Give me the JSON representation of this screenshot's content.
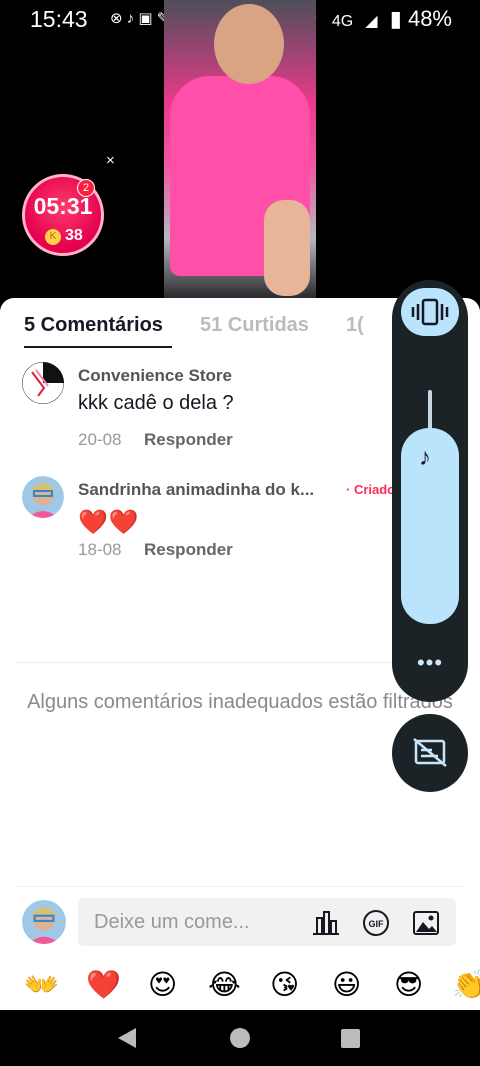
{
  "status_bar": {
    "time": "15:43",
    "left_icons": "⊗ ♪ ▣ ✎ ⊡",
    "network": "4G",
    "battery": "48%"
  },
  "timer": {
    "time": "05:31",
    "coins": "38",
    "badge": "2",
    "close": "×"
  },
  "tabs": [
    {
      "label": "5 Comentários"
    },
    {
      "label": "51 Curtidas"
    },
    {
      "label": "1("
    }
  ],
  "comments": [
    {
      "name": "Convenience Store",
      "text": "kkk cadê o  dela ?",
      "date": "20-08",
      "reply": "Responder"
    },
    {
      "name": "Sandrinha animadinha do k...",
      "creator_tag": "· Criado",
      "text": "❤️❤️",
      "date": "18-08",
      "reply": "Responder"
    }
  ],
  "filtered_notice": "Alguns comentários inadequados estão filtrados",
  "input": {
    "placeholder": "Deixe um come...",
    "icons": [
      "chart-icon",
      "gif-icon",
      "image-icon"
    ],
    "gif_label": "GIF"
  },
  "emojis": [
    "👐",
    "❤️",
    "😍",
    "😂",
    "😘",
    "😃",
    "😎",
    "👏"
  ],
  "volume_panel": {
    "more": "•••"
  },
  "colors": {
    "accent_red": "#fe2c55",
    "panel_bg": "#1c2326",
    "panel_accent": "#b9e4fb"
  }
}
